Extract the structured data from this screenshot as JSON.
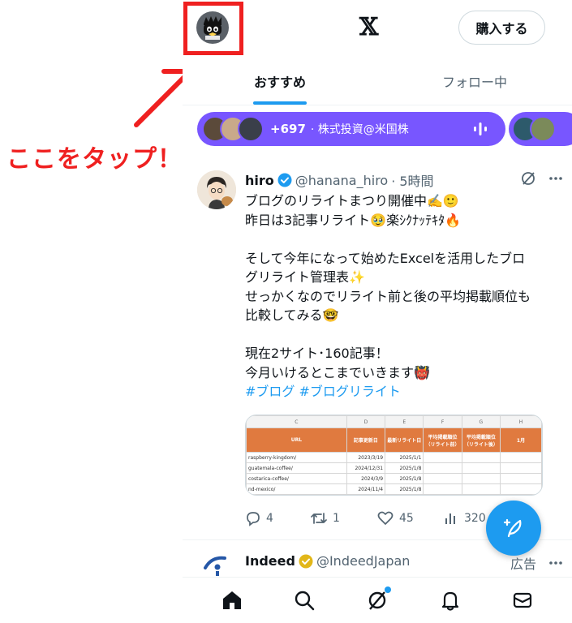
{
  "header": {
    "logo": "𝕏",
    "buy_label": "購入する"
  },
  "tabs": [
    {
      "label": "おすすめ",
      "active": true
    },
    {
      "label": "フォロー中",
      "active": false
    }
  ],
  "spaces": {
    "count": "+697",
    "title": "· 株式投資@米国株"
  },
  "tweet": {
    "name": "hiro",
    "handle": "@hanana_hiro",
    "time": "· 5時間",
    "lines": [
      "ブログのリライトまつり開催中✍️🙂",
      "昨日は3記事リライト🥹楽ｼｸﾅｯﾃｷﾀ🔥",
      "",
      "そして今年になって始めたExcelを活用したブロ",
      "グリライト管理表✨",
      "せっかくなのでリライト前と後の平均掲載順位も",
      "比較してみる🤓",
      "",
      "現在2サイト･160記事！",
      "今月いけるとこまでいきます👹"
    ],
    "hashtags": "#ブログ #ブログリライト",
    "sheet": {
      "columns": [
        "C",
        "D",
        "E",
        "F",
        "G",
        "H"
      ],
      "headers": [
        "URL",
        "記事更新日",
        "最新リライト日",
        "平均掲載順位（リライト前）",
        "平均掲載順位（リライト後）",
        "1月"
      ],
      "rows": [
        [
          "raspberry-kingdom/",
          "2023/3/19",
          "2025/1/1"
        ],
        [
          "guatemala-coffee/",
          "2024/12/31",
          "2025/1/8"
        ],
        [
          "costarica-coffee/",
          "2024/3/9",
          "2025/1/8"
        ],
        [
          "nd-mexico/",
          "2024/11/4",
          "2025/1/8"
        ]
      ]
    },
    "actions": {
      "replies": "4",
      "retweets": "1",
      "likes": "45",
      "views": "320"
    }
  },
  "tweet2": {
    "name": "Indeed",
    "handle": "@IndeedJapan",
    "ad_label": "広告"
  },
  "annotation": {
    "text": "ここをタップ！"
  },
  "colors": {
    "accent": "#1d9bf0",
    "spaces": "#7856ff",
    "annotation": "#ef2020"
  }
}
